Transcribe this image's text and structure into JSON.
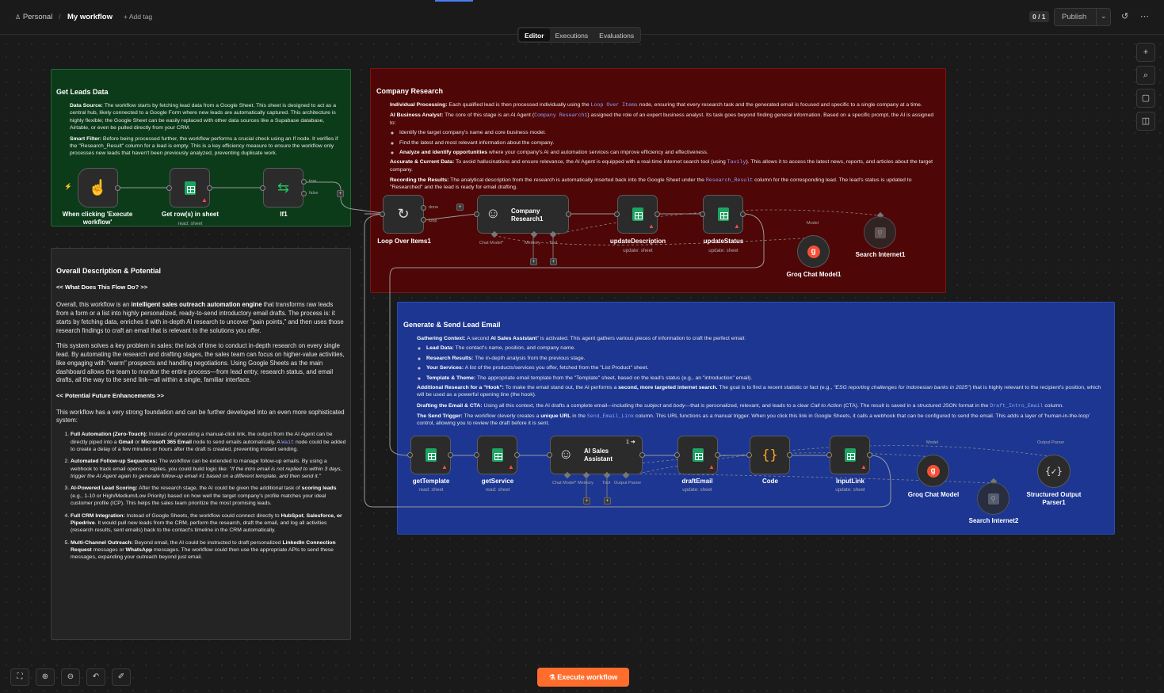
{
  "header": {
    "project": "Personal",
    "workflow": "My workflow",
    "add_tag": "+ Add tag",
    "counter": "0 / 1",
    "publish": "Publish",
    "icons": [
      "person-icon",
      "chevron-down-icon",
      "history-icon",
      "more-icon"
    ]
  },
  "tabs": [
    {
      "label": "Editor"
    },
    {
      "label": "Executions"
    },
    {
      "label": "Evaluations"
    }
  ],
  "right_tools": [
    "+",
    "⌕",
    "▢",
    "◫"
  ],
  "notes": {
    "get_leads": {
      "title": "Get Leads Data",
      "bullets": [
        {
          "label": "Data Source:",
          "text": " The workflow starts by fetching lead data from a Google Sheet. This sheet is designed to act as a central hub, likely connected to a Google Form where new leads are automatically captured. This architecture is highly flexible; the Google Sheet can be easily replaced with other data sources like a Supabase database, Airtable, or even be pulled directly from your CRM."
        },
        {
          "label": "Smart Filter:",
          "text": " Before being processed further, the workflow performs a crucial check using an If node. It verifies if the \"Research_Result\" column for a lead is empty. This is a key efficiency measure to ensure the workflow only processes new leads that haven't been previously analyzed, preventing duplicate work."
        }
      ]
    },
    "company_research": {
      "title": "Company Research",
      "b1_label": "Individual Processing:",
      "b1_text_a": " Each qualified lead is then processed individually using the ",
      "b1_code": "Loop Over Items",
      "b1_text_b": " node, ensuring that every research task and the generated email is focused and specific to a single company at a time.",
      "b2_label": "AI Business Analyst:",
      "b2_text_a": " The core of this stage is an AI Agent (",
      "b2_code": "Company Research1",
      "b2_text_b": ") assigned the role of an expert business analyst. Its task goes beyond finding general information. Based on a specific prompt, the AI is assigned to:",
      "sub1": "Identify the target company's name and core business model.",
      "sub2": "Find the latest and most relevant information about the company.",
      "sub3_label": "Analyze and identify opportunities",
      "sub3_text": " where your company's AI and automation services can improve efficiency and effectiveness.",
      "b3_label": "Accurate & Current Data:",
      "b3_text_a": " To avoid hallucinations and ensure relevance, the AI Agent is equipped with a real-time internet search tool (using ",
      "b3_code": "Tavily",
      "b3_text_b": "). This allows it to access the latest news, reports, and articles about the target company.",
      "b4_label": "Recording the Results:",
      "b4_text_a": " The analytical description from the research is automatically inserted back into the Google Sheet under the ",
      "b4_code": "Research_Result",
      "b4_text_b": " column for the corresponding lead. The lead's status is updated to \"Researched\" and the lead is ready for email drafting."
    },
    "generate_email": {
      "title": "Generate & Send Lead Email",
      "b1_label": "Gathering Context:",
      "b1_text_a": " A second ",
      "b1_bold": "AI Sales Assistant",
      "b1_text_b": "\" is activated. This agent gathers various pieces of information to craft the perfect email:",
      "subs": [
        {
          "label": "Lead Data:",
          "text": " The contact's name, position, and company name."
        },
        {
          "label": "Research Results:",
          "text": " The in-depth analysis from the previous stage."
        },
        {
          "label": "Your Services:",
          "text": " A list of the products/services you offer, fetched from the \"List Product\" sheet."
        },
        {
          "label": "Template & Theme:",
          "text": " The appropriate email template from the \"Template\" sheet, based on the lead's status (e.g., an \"introduction\" email)."
        }
      ],
      "b2_label": "Additional Research for a \"Hook\":",
      "b2_text_a": " To make the email stand out, the AI performs a ",
      "b2_bold": "second, more targeted internet search.",
      "b2_text_b": " The goal is to find a recent statistic or fact (e.g., ",
      "b2_italic": "\"ESG reporting challenges for Indonesian banks in 2025\"",
      "b2_text_c": ") that is highly relevant to the recipient's position, which will be used as a powerful opening line (the hook).",
      "b3_label": "Drafting the Email & CTA:",
      "b3_text_a": " Using all this context, the AI drafts a complete email—including the ",
      "b3_i1": "subject",
      "b3_text_b": " and ",
      "b3_i2": "body",
      "b3_text_c": "—that is personalized, relevant, and leads to a clear ",
      "b3_i3": "Call to Action",
      "b3_text_d": " (CTA). The result is saved in a structured JSON format in the ",
      "b3_code": "Draft_Intro_Email",
      "b3_text_e": " column.",
      "b4_label": "The Send Trigger:",
      "b4_text_a": " The workflow cleverly creates a ",
      "b4_bold": "unique URL",
      "b4_text_b": " in the ",
      "b4_code": "Send_Email_Link",
      "b4_text_c": " column. This URL functions as a manual trigger. When you click this link in Google Sheets, it calls a webhook that can be configured to send the email. This adds a layer of 'human-in-the-loop' control, allowing you to review the draft before it is sent."
    },
    "overall": {
      "title": "Overall Description & Potential",
      "h1": "<< What Does This Flow Do? >>",
      "p1_a": "Overall, this workflow is an ",
      "p1_bold": "intelligent sales outreach automation engine",
      "p1_b": " that transforms raw leads from a form or a list into highly personalized, ready-to-send introductory email drafts. The process is: it starts by fetching data, enriches it with in-depth AI research to uncover \"pain points,\" and then uses those research findings to craft an email that is relevant to the solutions you offer.",
      "p2": "This system solves a key problem in sales: the lack of time to conduct in-depth research on every single lead. By automating the research and drafting stages, the sales team can focus on higher-value activities, like engaging with \"warm\" prospects and handling negotiations. Using Google Sheets as the main dashboard allows the team to monitor the entire process—from lead entry, research status, and email drafts, all the way to the send link—all within a single, familiar interface.",
      "h2": "<< Potential Future Enhancements >>",
      "p3": "This workflow has a very strong foundation and can be further developed into an even more sophisticated system:",
      "items": [
        {
          "label": "Full Automation (Zero-Touch):",
          "a": " Instead of generating a manual-click link, the output from the AI Agent can be directly piped into a ",
          "b1": "Gmail",
          "mid": " or ",
          "b2": "Microsoft 365 Email",
          "b": " node to send emails automatically. A ",
          "code": "Wait",
          "c": " node could be added to create a delay of a few minutes or hours after the draft is created, preventing instant sending."
        },
        {
          "label": "Automated Follow-up Sequences:",
          "a": " The workflow can be extended to manage follow-up emails. By using a webhook to track email opens or replies, you could build logic like: ",
          "i": "\"If the intro email is not replied to within 3 days, trigger the AI Agent again to generate follow-up email #1 based on a different template, and then send it.\""
        },
        {
          "label": "AI-Powered Lead Scoring:",
          "a": " After the research stage, the AI could be given the additional task of ",
          "b1": "scoring leads",
          "b": " (e.g., 1-10 or High/Medium/Low Priority) based on how well the target company's profile matches your ideal customer profile (ICP). This helps the sales team prioritize the most promising leads."
        },
        {
          "label": "Full CRM Integration:",
          "a": " Instead of Google Sheets, the workflow could connect directly to ",
          "b1": "HubSpot",
          "mid": ", ",
          "b2": "Salesforce, or Pipedrive",
          "b": ". It would pull new leads from the CRM, perform the research, draft the email, and log all activities (research results, sent emails) back to the contact's timeline in the CRM automatically."
        },
        {
          "label": "Multi-Channel Outreach:",
          "a": " Beyond email, the AI could be instructed to draft personalized ",
          "b1": "LinkedIn Connection Request",
          "mid": " messages or ",
          "b2": "WhatsApp",
          "b": " messages. The workflow could then use the appropriate APIs to send these messages, expanding your outreach beyond just email."
        }
      ]
    }
  },
  "nodes": {
    "trigger": {
      "label": "When clicking 'Execute workflow'"
    },
    "get_rows": {
      "label": "Get row(s) in sheet",
      "sub": "read: sheet"
    },
    "if1": {
      "label": "If1",
      "true": "true",
      "false": "false"
    },
    "loop": {
      "label": "Loop Over Items1",
      "done": "done",
      "loop": "loop"
    },
    "company_research": {
      "label1": "Company",
      "label2": "Research1",
      "ports": [
        "Chat Model*",
        "Memory",
        "Tool"
      ]
    },
    "update_desc": {
      "label": "updateDescription",
      "sub": "update: sheet"
    },
    "update_status": {
      "label": "updateStatus",
      "sub": "update: sheet"
    },
    "groq1": {
      "label": "Groq Chat Model1",
      "top": "Model"
    },
    "search1": {
      "label": "Search Internet1"
    },
    "get_template": {
      "label": "getTemplate",
      "sub": "read: sheet"
    },
    "get_service": {
      "label": "getService",
      "sub": "read: sheet"
    },
    "ai_sales": {
      "label1": "AI Sales",
      "label2": "Assistant",
      "badge": "1",
      "ports": [
        "Chat Model*",
        "Memory",
        "Tool",
        "Output Parser"
      ]
    },
    "draft_email": {
      "label": "draftEmail",
      "sub": "update: sheet"
    },
    "code": {
      "label": "Code"
    },
    "input_link": {
      "label": "InputLink",
      "sub": "update: sheet"
    },
    "groq2": {
      "label": "Groq Chat Model",
      "top": "Model"
    },
    "search2": {
      "label": "Search Internet2"
    },
    "parser": {
      "label1": "Structured Output",
      "label2": "Parser1",
      "top": "Output Parser"
    }
  },
  "bottom_tools": [
    "⛶",
    "⊕",
    "⊖",
    "↶",
    "✐"
  ],
  "execute": "Execute workflow",
  "colors": {
    "accent": "#ff6d2d",
    "green_note": "#0c3b1a",
    "red_note": "#4f0606",
    "blue_note": "#1c3691",
    "gray_note": "#242424"
  }
}
